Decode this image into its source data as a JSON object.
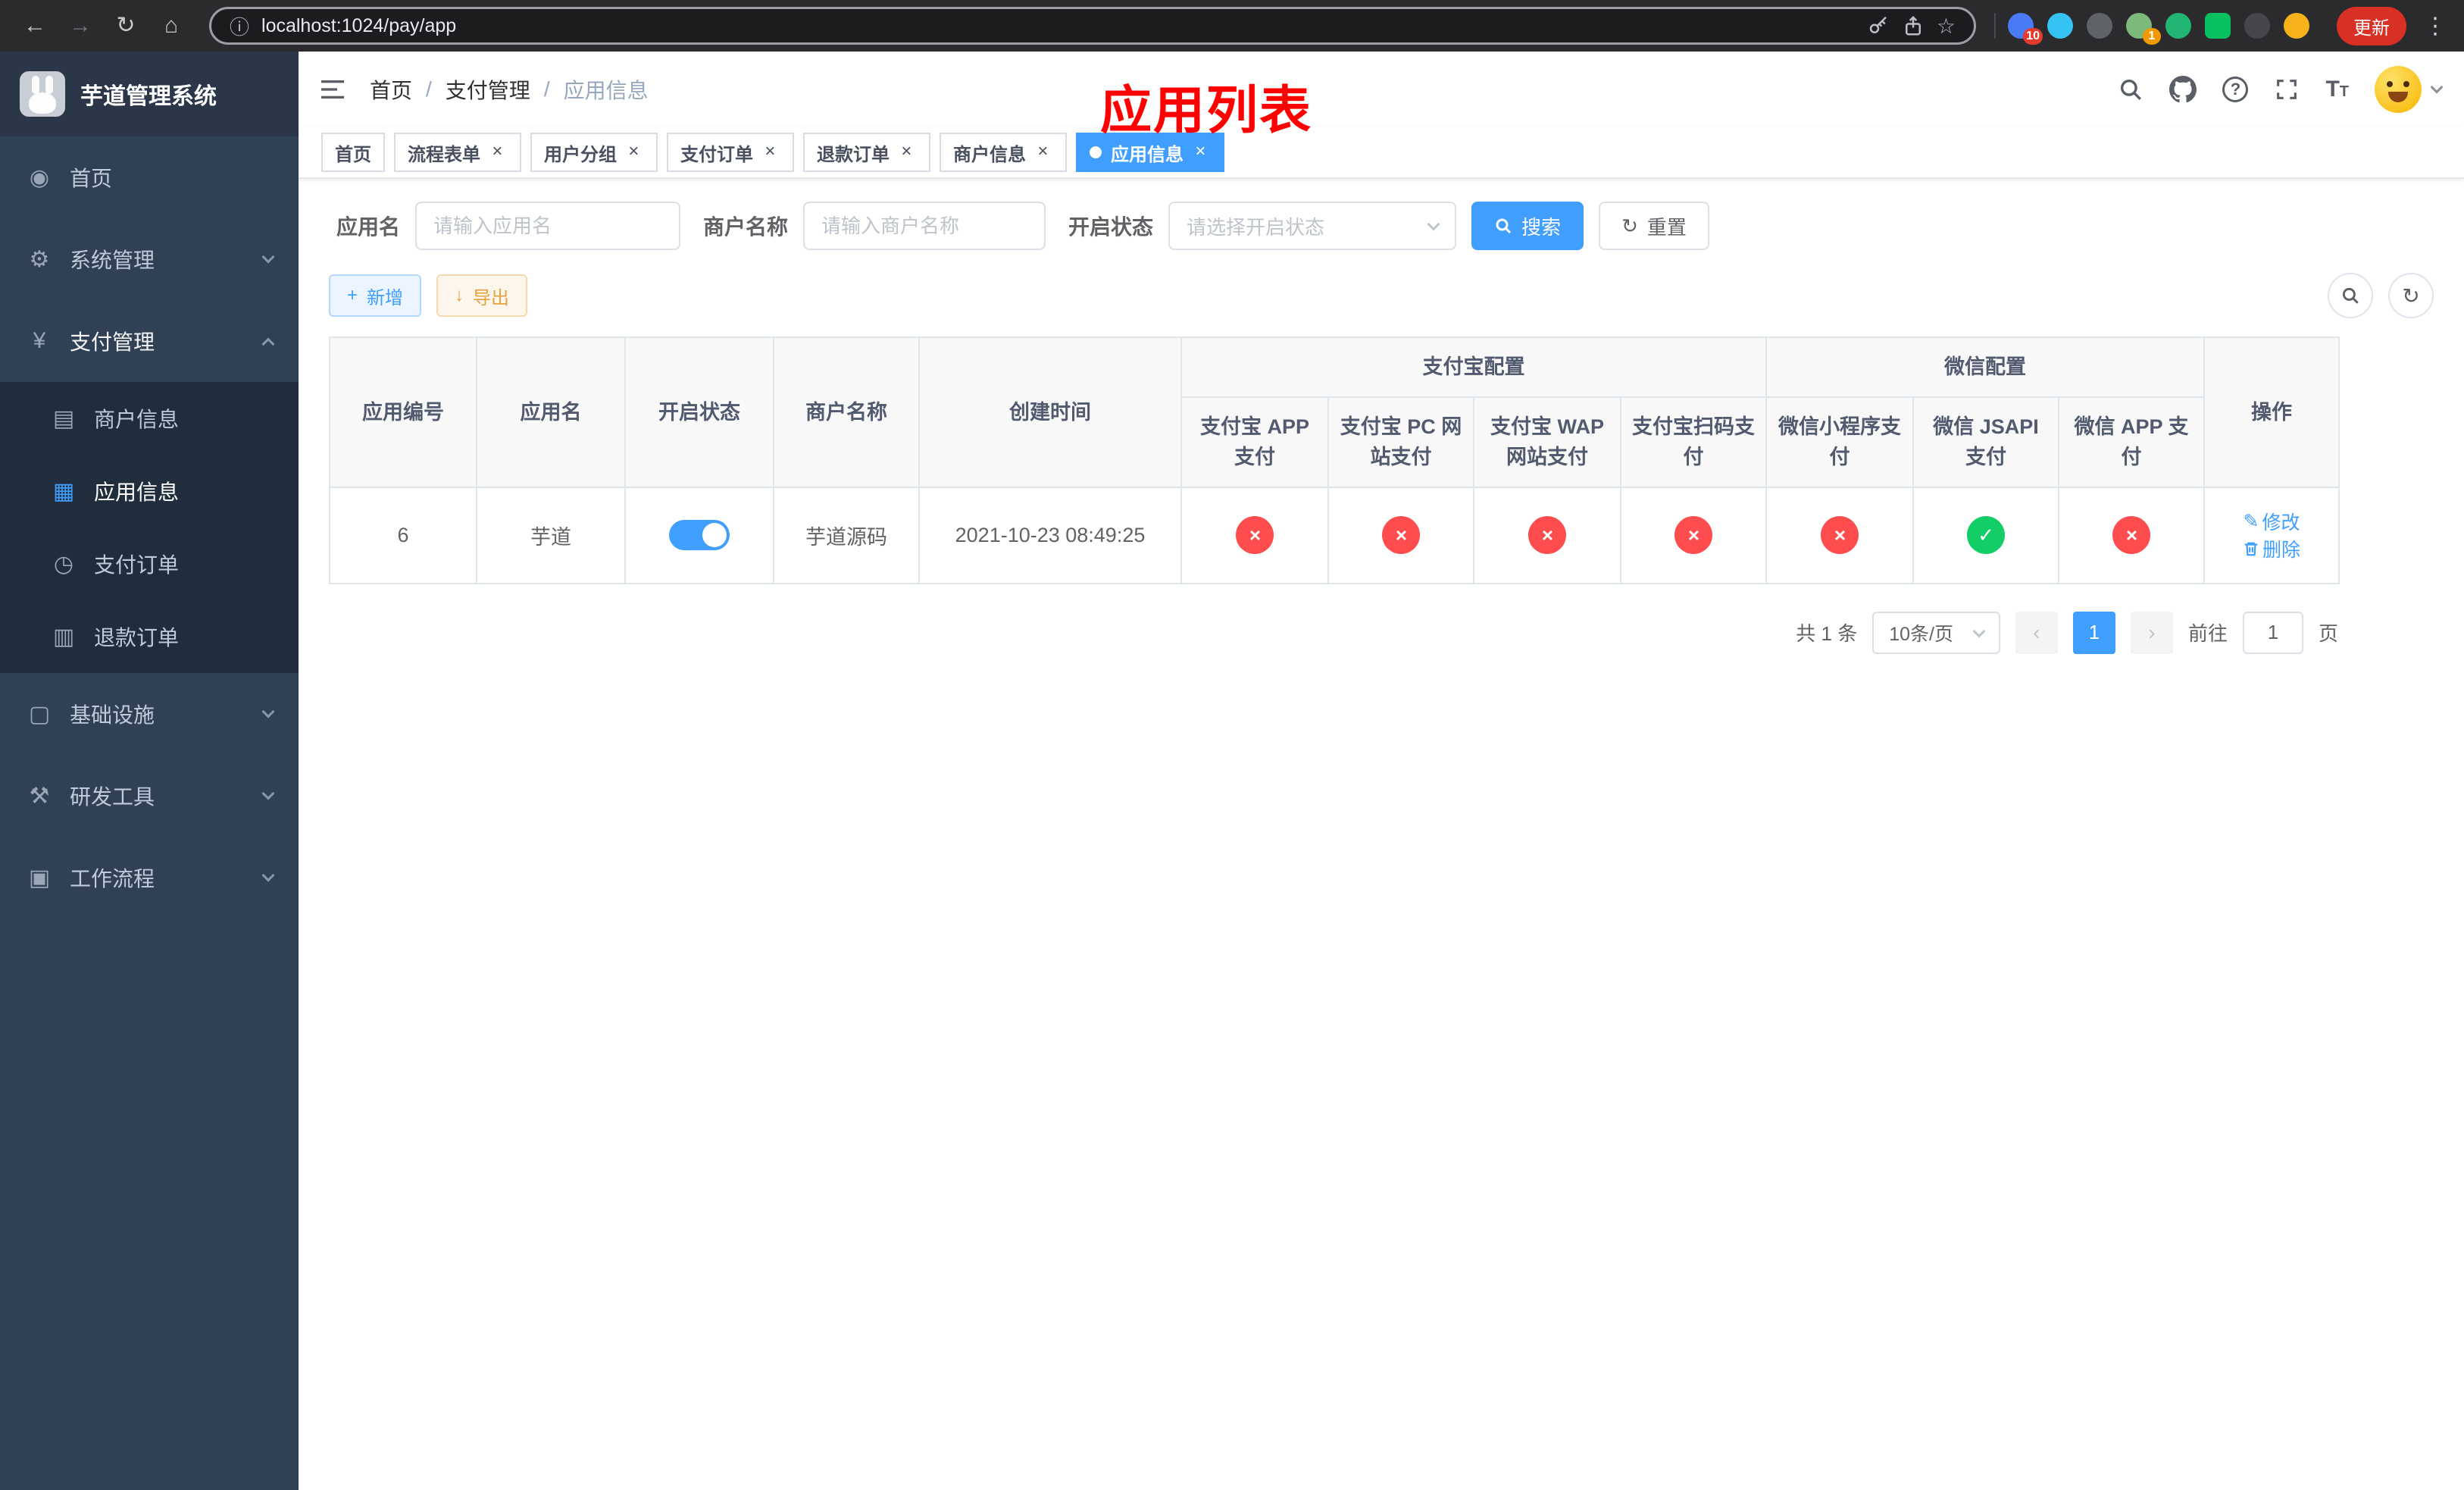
{
  "browser": {
    "url": "localhost:1024/pay/app",
    "update_label": "更新",
    "ext_badge_1": "10",
    "ext_badge_2": "1"
  },
  "icons": {
    "back": "←",
    "forward": "→",
    "reload": "↻",
    "home": "⌂",
    "info": "ⓘ",
    "star": "☆",
    "kebab": "⋮",
    "close": "×",
    "plus": "+",
    "download": "↓",
    "refresh": "↻",
    "prev": "‹",
    "next": "›",
    "fail": "×",
    "success": "✓",
    "pencil": "✎",
    "help": "?",
    "font_large": "T",
    "font_small": "T"
  },
  "sidebar": {
    "title": "芋道管理系统",
    "icons": {
      "home": "◉",
      "system": "⚙",
      "payment": "¥",
      "merchant": "▤",
      "app": "▦",
      "order": "◷",
      "refund": "▥",
      "infra": "▢",
      "devtools": "⚒",
      "workflow": "▣"
    },
    "items": {
      "home": "首页",
      "system": "系统管理",
      "payment": "支付管理",
      "merchant": "商户信息",
      "app": "应用信息",
      "order": "支付订单",
      "refund": "退款订单",
      "infra": "基础设施",
      "devtools": "研发工具",
      "workflow": "工作流程"
    }
  },
  "header": {
    "breadcrumb": [
      "首页",
      "支付管理",
      "应用信息"
    ],
    "overlay_title": "应用列表"
  },
  "tabs": [
    {
      "label": "首页",
      "closable": false,
      "active": false
    },
    {
      "label": "流程表单",
      "closable": true,
      "active": false
    },
    {
      "label": "用户分组",
      "closable": true,
      "active": false
    },
    {
      "label": "支付订单",
      "closable": true,
      "active": false
    },
    {
      "label": "退款订单",
      "closable": true,
      "active": false
    },
    {
      "label": "商户信息",
      "closable": true,
      "active": false
    },
    {
      "label": "应用信息",
      "closable": true,
      "active": true
    }
  ],
  "filters": {
    "app_name_label": "应用名",
    "app_name_placeholder": "请输入应用名",
    "merchant_label": "商户名称",
    "merchant_placeholder": "请输入商户名称",
    "status_label": "开启状态",
    "status_placeholder": "请选择开启状态",
    "search_label": "搜索",
    "reset_label": "重置"
  },
  "toolbar": {
    "add": "新增",
    "export": "导出"
  },
  "table": {
    "headers": {
      "id": "应用编号",
      "name": "应用名",
      "status": "开启状态",
      "merchant": "商户名称",
      "created": "创建时间",
      "alipay_group": "支付宝配置",
      "wechat_group": "微信配置",
      "alipay_app": "支付宝 APP 支付",
      "alipay_pc": "支付宝 PC 网站支付",
      "alipay_wap": "支付宝 WAP 网站支付",
      "alipay_qr": "支付宝扫码支付",
      "wx_mini": "微信小程序支付",
      "wx_jsapi": "微信 JSAPI 支付",
      "wx_app": "微信 APP 支付",
      "actions": "操作"
    },
    "rows": [
      {
        "id": "6",
        "name": "芋道",
        "status_on": true,
        "merchant": "芋道源码",
        "created": "2021-10-23 08:49:25",
        "alipay_app": "disabled",
        "alipay_pc": "disabled",
        "alipay_wap": "disabled",
        "alipay_qr": "disabled",
        "wx_mini": "disabled",
        "wx_jsapi": "enabled",
        "wx_app": "disabled",
        "edit": "修改",
        "delete": "删除"
      }
    ]
  },
  "pagination": {
    "total": "共 1 条",
    "size": "10条/页",
    "page": "1",
    "goto": "前往",
    "goto_value": "1",
    "unit": "页"
  },
  "colors": {
    "accent": "#409eff",
    "fail": "#ff4d4f",
    "success": "#13ce66",
    "warning": "#e6a23c",
    "overlay": "#ff0000"
  }
}
